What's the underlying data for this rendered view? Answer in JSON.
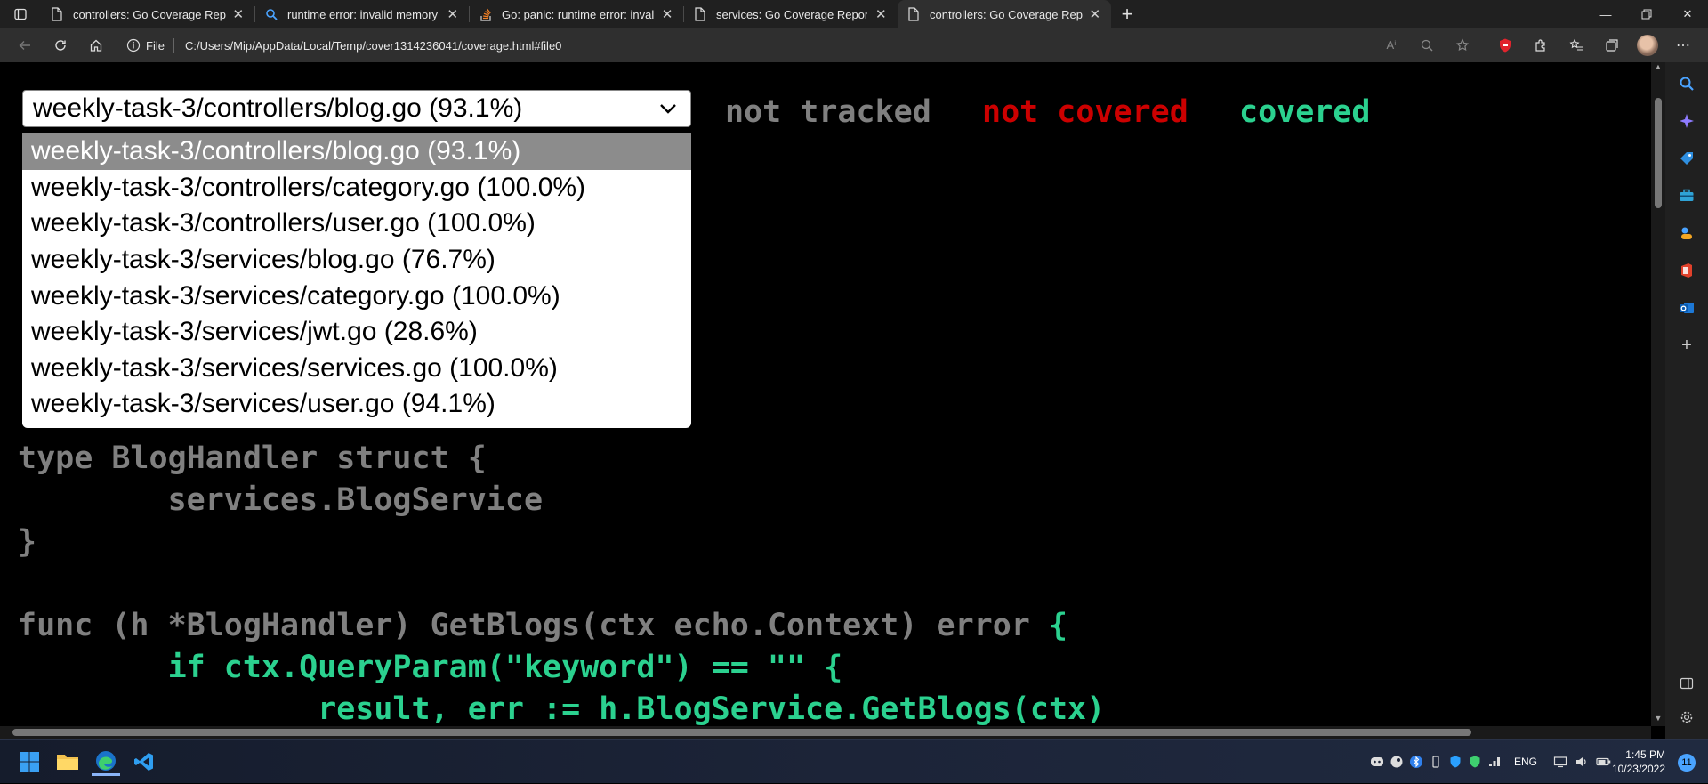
{
  "browser": {
    "tabs": [
      {
        "title": "controllers: Go Coverage Report",
        "favicon": "page-icon",
        "active": false
      },
      {
        "title": "runtime error: invalid memory ad",
        "favicon": "search-icon",
        "active": false
      },
      {
        "title": "Go: panic: runtime error: invalid m",
        "favicon": "stackoverflow-icon",
        "active": false
      },
      {
        "title": "services: Go Coverage Report",
        "favicon": "page-icon",
        "active": false
      },
      {
        "title": "controllers: Go Coverage Report",
        "favicon": "page-icon",
        "active": true
      }
    ],
    "address": {
      "scheme_label": "File",
      "url": "C:/Users/Mip/AppData/Local/Temp/cover1314236041/coverage.html#file0"
    }
  },
  "report": {
    "selected_file": "weekly-task-3/controllers/blog.go (93.1%)",
    "legend": {
      "not_tracked": "not tracked",
      "not_covered": "not covered",
      "covered": "covered"
    },
    "files": [
      {
        "label": "weekly-task-3/controllers/blog.go (93.1%)",
        "selected": true
      },
      {
        "label": "weekly-task-3/controllers/category.go (100.0%)",
        "selected": false
      },
      {
        "label": "weekly-task-3/controllers/user.go (100.0%)",
        "selected": false
      },
      {
        "label": "weekly-task-3/services/blog.go (76.7%)",
        "selected": false
      },
      {
        "label": "weekly-task-3/services/category.go (100.0%)",
        "selected": false
      },
      {
        "label": "weekly-task-3/services/jwt.go (28.6%)",
        "selected": false
      },
      {
        "label": "weekly-task-3/services/services.go (100.0%)",
        "selected": false
      },
      {
        "label": "weekly-task-3/services/user.go (94.1%)",
        "selected": false
      }
    ],
    "code_lines": [
      [
        {
          "text": "type BlogHandler struct {",
          "cls": "nt"
        }
      ],
      [
        {
          "text": "        services.BlogService",
          "cls": "nt"
        }
      ],
      [
        {
          "text": "}",
          "cls": "nt"
        }
      ],
      [
        {
          "text": "",
          "cls": "nt"
        }
      ],
      [
        {
          "text": "func (h *BlogHandler) GetBlogs(ctx echo.Context) error ",
          "cls": "nt"
        },
        {
          "text": "{",
          "cls": "cv"
        }
      ],
      [
        {
          "text": "        if ctx.QueryParam(\"keyword\") == \"\" {",
          "cls": "cv"
        }
      ],
      [
        {
          "text": "                result, err := h.BlogService.GetBlogs(ctx)",
          "cls": "cv"
        }
      ]
    ]
  },
  "taskbar": {
    "language": "ENG",
    "time": "1:45 PM",
    "date": "10/23/2022",
    "notification_count": "11"
  },
  "colors": {
    "not_tracked": "#808080",
    "not_covered": "#cc0000",
    "covered": "#2bd18f"
  }
}
